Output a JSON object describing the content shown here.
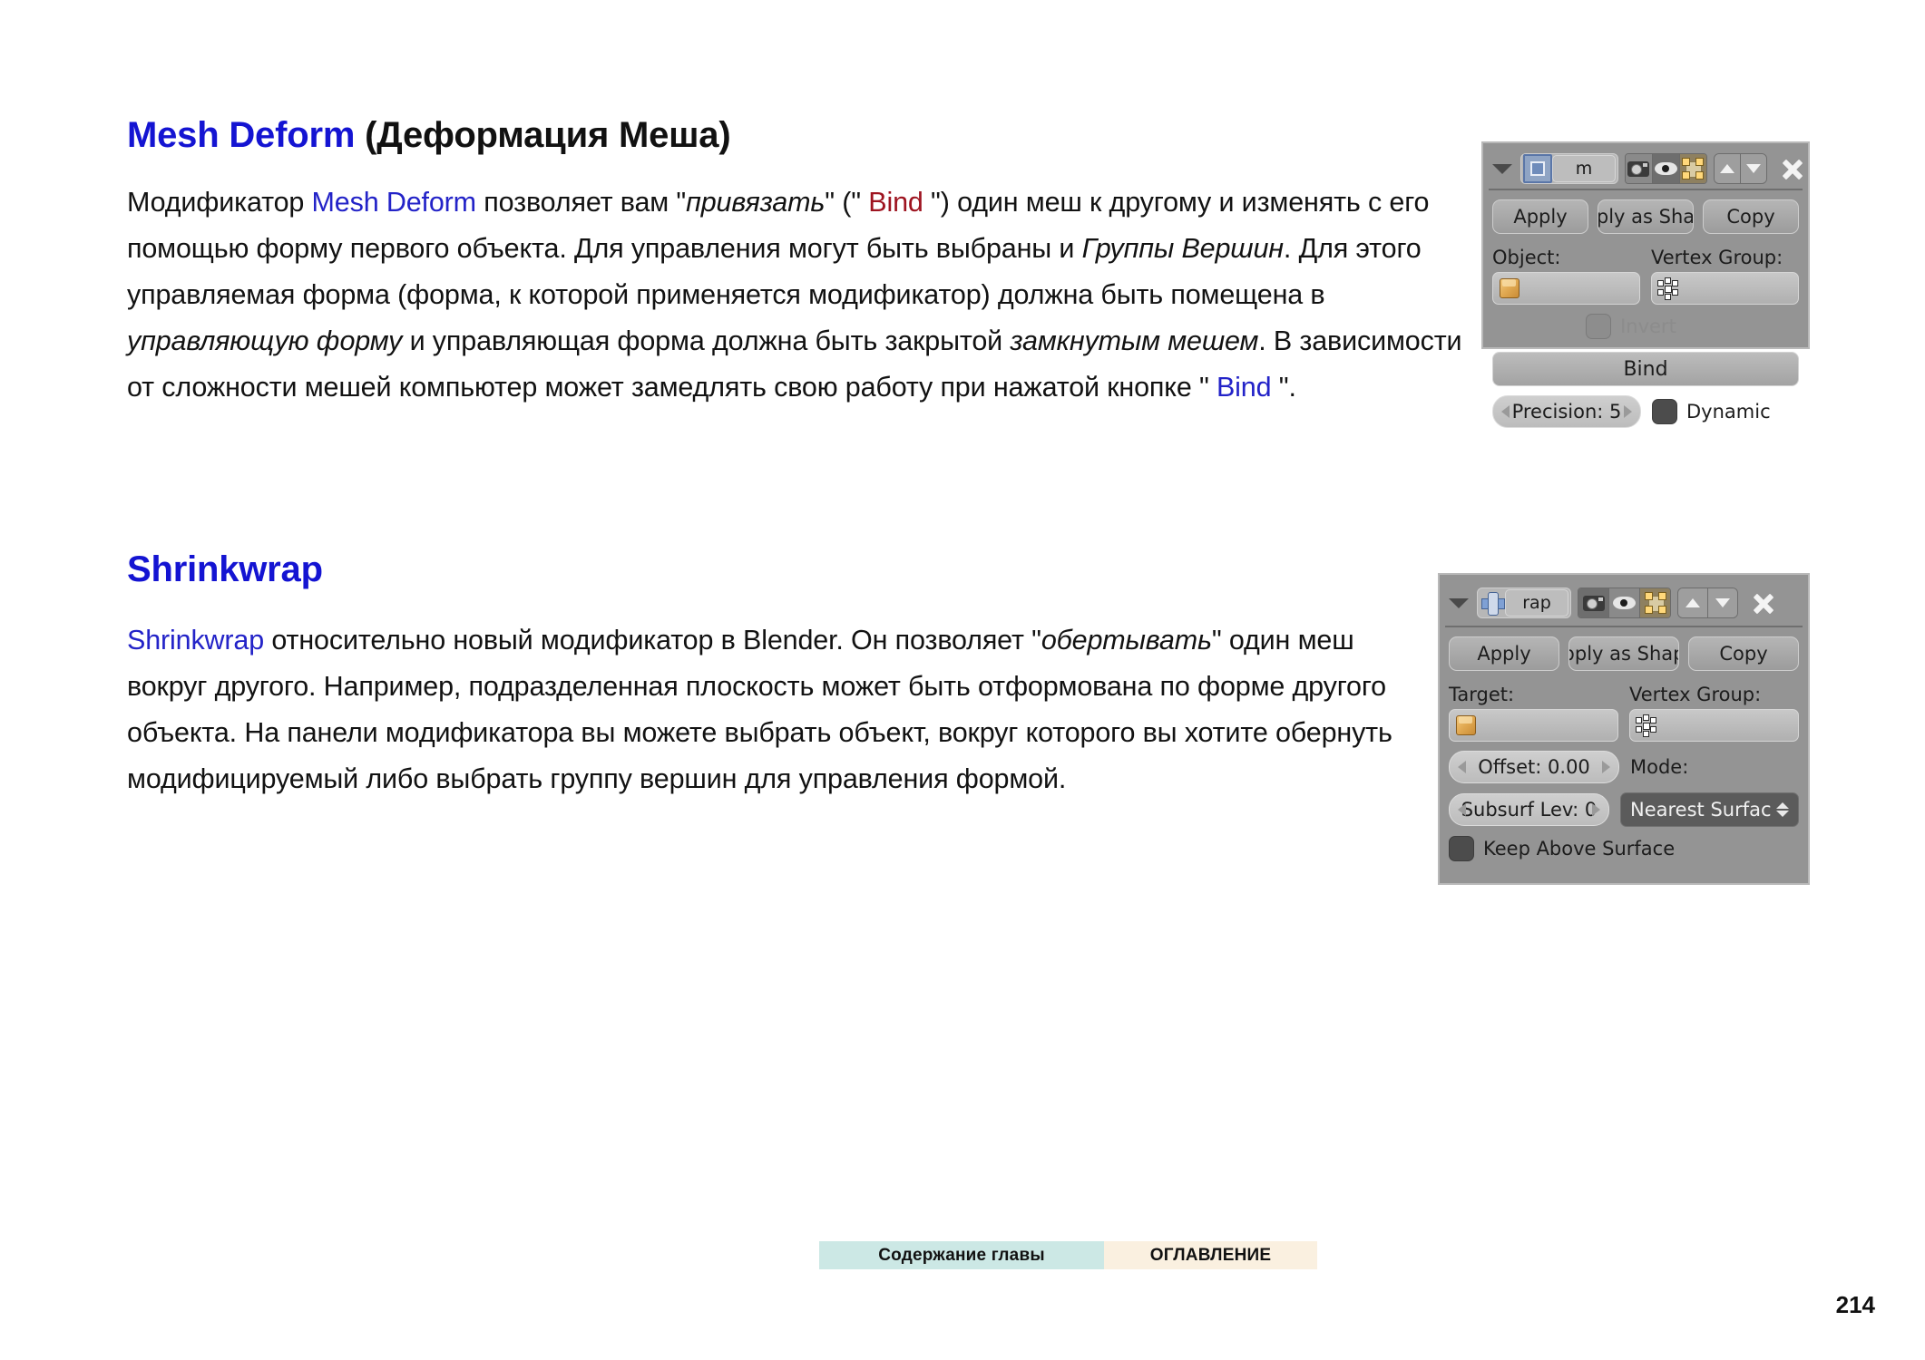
{
  "document": {
    "page_number": "214"
  },
  "sections": [
    {
      "id": "mesh_deform",
      "heading_en": "Mesh Deform",
      "heading_ru": " (Деформация Меша)",
      "paragraph": {
        "p1": "Модификатор ",
        "link1": "Mesh Deform",
        "p2": " позволяет вам \"",
        "it1": "привязать",
        "p3": "\" (\" ",
        "red1": "Bind",
        "p4": " \") один меш к другому и изменять с его помощью форму первого объекта. Для управления могут быть выбраны и ",
        "it2": "Группы Вершин",
        "p5": ". Для этого управляемая форма (форма, к которой применяется модификатор) должна быть помещена в ",
        "it3": "управляющую форму",
        "p6": " и управляющая форма должна быть закрытой ",
        "it4": "замкнутым мешем",
        "p7": ". В зависимости от сложности мешей компьютер может замедлять свою работу при нажатой кнопке \" ",
        "blue1": "Bind",
        "p8": " \"."
      }
    },
    {
      "id": "shrinkwrap",
      "heading_en": "Shrinkwrap",
      "heading_ru": "",
      "paragraph": {
        "link1": "Shrinkwrap",
        "p1": " относительно новый модификатор в Blender. Он позволяет \"",
        "it1": "обертывать",
        "p2": "\" один меш вокруг другого. Например, подразделенная плоскость может быть отформована по форме другого объекта. На панели модификатора вы можете выбрать объект, вокруг которого вы хотите обернуть модифицируемый либо выбрать группу вершин для управления формой."
      }
    }
  ],
  "panels": {
    "mesh_deform": {
      "modifier_name": "m",
      "icons": {
        "collapse": "triangle-down-icon",
        "type": "mesh-deform-icon",
        "render": "camera-icon",
        "realtime": "eye-icon",
        "editmode": "edit-mode-icon",
        "move_up": "arrow-up-icon",
        "move_down": "arrow-down-icon",
        "delete": "close-x-icon"
      },
      "buttons": {
        "apply": "Apply",
        "apply_as_shape": "ply as Sha",
        "copy": "Copy"
      },
      "labels": {
        "object": "Object:",
        "vertex_group": "Vertex Group:",
        "invert": "Invert"
      },
      "object_value": "",
      "vertex_group_value": "",
      "bind_button": "Bind",
      "precision": "Precision: 5",
      "dynamic": "Dynamic"
    },
    "shrinkwrap": {
      "modifier_name": "rap",
      "icons": {
        "collapse": "triangle-down-icon",
        "type": "shrinkwrap-icon",
        "render": "camera-icon",
        "realtime": "eye-icon",
        "editmode": "edit-mode-icon",
        "move_up": "arrow-up-icon",
        "move_down": "arrow-down-icon",
        "delete": "close-x-icon"
      },
      "buttons": {
        "apply": "Apply",
        "apply_as_shape": "pply as Shap",
        "copy": "Copy"
      },
      "labels": {
        "target": "Target:",
        "vertex_group": "Vertex Group:",
        "mode": "Mode:"
      },
      "target_value": "",
      "vertex_group_value": "",
      "offset": "Offset: 0.00",
      "subsurf_level": "Subsurf Lev: 0",
      "mode_value": "Nearest Surfac",
      "keep_above_surface": "Keep Above Surface"
    }
  },
  "footer": {
    "chapter_contents": "Содержание главы",
    "table_of_contents": "ОГЛАВЛЕНИЕ"
  },
  "colors": {
    "heading_blue": "#1414d2",
    "link_blue": "#2323c8",
    "bind_red": "#9e1420",
    "panel_bg": "#949494",
    "footer_chapter_bg": "#cce8e5",
    "footer_toc_bg": "#faf0e0"
  }
}
